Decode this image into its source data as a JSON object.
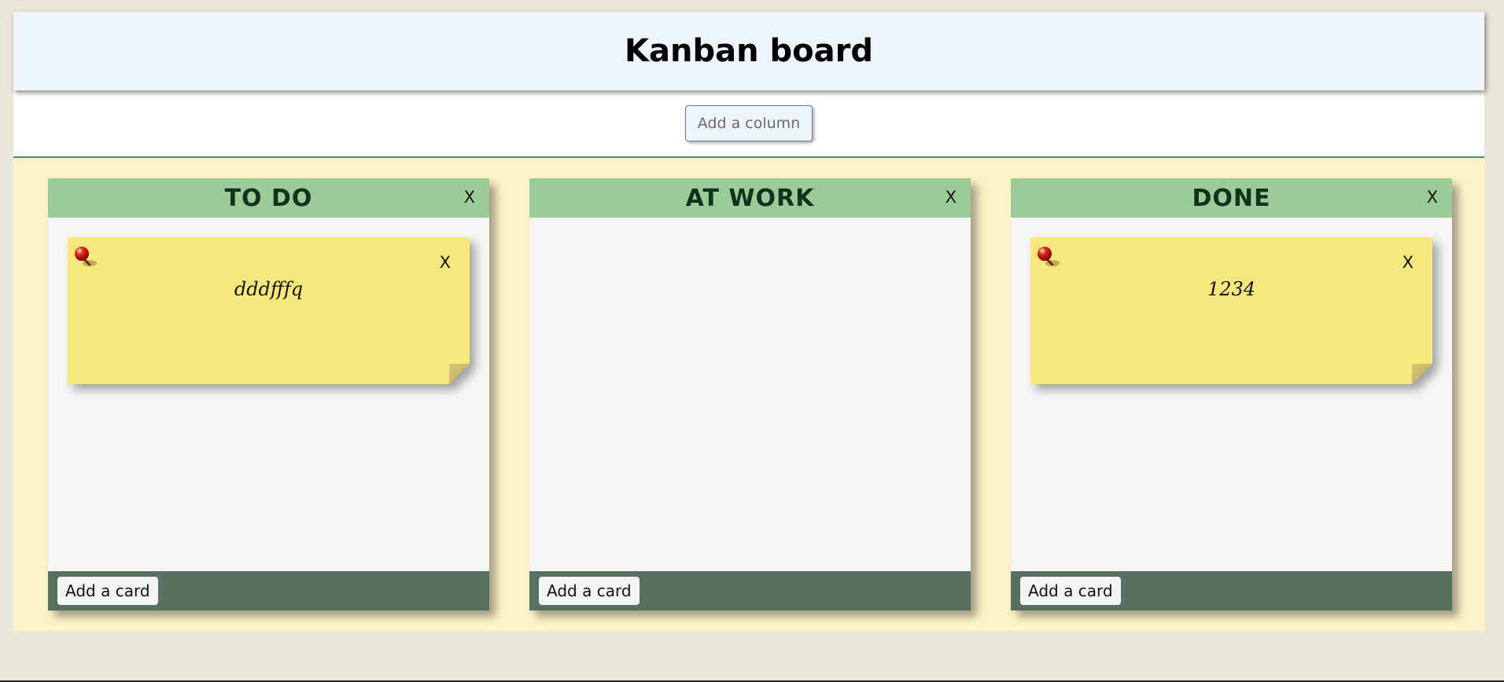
{
  "header": {
    "title": "Kanban board"
  },
  "toolbar": {
    "add_column_label": "Add a column"
  },
  "colors": {
    "background": "#e9e6da",
    "header_bg": "#eef5fd",
    "board_bg": "#fdf3c8",
    "column_header": "#9acb99",
    "column_footer": "#57705f",
    "card": "#f7e87d",
    "pin": "#c8160c"
  },
  "columns": [
    {
      "title": "TO DO",
      "close_label": "X",
      "add_card_label": "Add a card",
      "cards": [
        {
          "text": "dddfffq",
          "close_label": "X",
          "icon": "pushpin-icon"
        }
      ]
    },
    {
      "title": "AT WORK",
      "close_label": "X",
      "add_card_label": "Add a card",
      "cards": []
    },
    {
      "title": "DONE",
      "close_label": "X",
      "add_card_label": "Add a card",
      "cards": [
        {
          "text": "1234",
          "close_label": "X",
          "icon": "pushpin-icon"
        }
      ]
    }
  ]
}
